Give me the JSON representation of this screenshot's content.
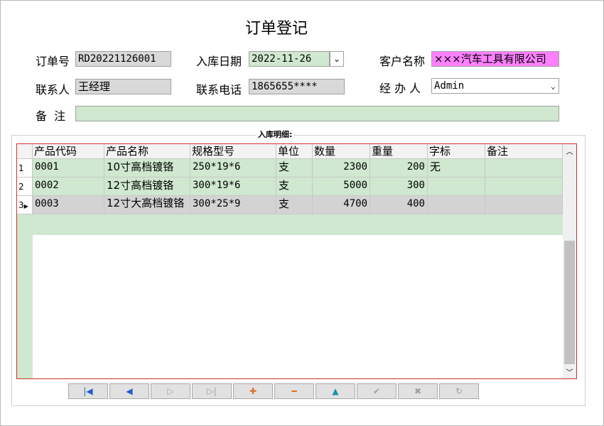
{
  "form": {
    "title": "订单登记",
    "order_no_label": "订单号",
    "order_no": "RD20221126001",
    "in_date_label": "入库日期",
    "in_date": "2022-11-26",
    "customer_label": "客户名称",
    "customer": "×××汽车工具有限公司",
    "contact_label": "联系人",
    "contact": "王经理",
    "phone_label": "联系电话",
    "phone": "1865655****",
    "handler_label": "经 办 人",
    "handler": "Admin",
    "remark_label": "备  注",
    "remark": ""
  },
  "detail": {
    "group_title": "入库明细:",
    "columns": [
      "产品代码",
      "产品名称",
      "规格型号",
      "单位",
      "数量",
      "重量",
      "字标",
      "备注"
    ],
    "rows": [
      {
        "num": "1",
        "code": "0001",
        "name": "10寸高档镀铬",
        "spec": "250*19*6",
        "unit": "支",
        "qty": "2300",
        "weight": "200",
        "mark": "无",
        "note": ""
      },
      {
        "num": "2",
        "code": "0002",
        "name": "12寸高档镀铬",
        "spec": "300*19*6",
        "unit": "支",
        "qty": "5000",
        "weight": "300",
        "mark": "",
        "note": ""
      },
      {
        "num": "3",
        "code": "0003",
        "name": "12寸大高档镀铬",
        "spec": "300*25*9",
        "unit": "支",
        "qty": "4700",
        "weight": "400",
        "mark": "",
        "note": ""
      }
    ]
  },
  "nav": {
    "first": "first-record-icon",
    "prev": "prev-record-icon",
    "next": "next-record-icon",
    "last": "last-record-icon",
    "add": "add-icon",
    "delete": "delete-icon",
    "edit": "edit-icon",
    "save": "save-icon",
    "cancel": "cancel-icon",
    "refresh": "refresh-icon"
  },
  "colors": {
    "field_green": "#cfe8cf",
    "field_pink": "#ff80ff",
    "grid_border": "#d03030"
  }
}
